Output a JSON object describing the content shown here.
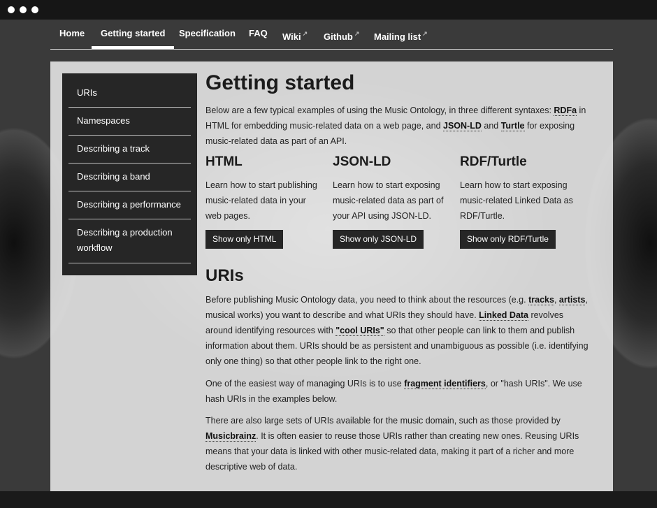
{
  "nav": {
    "items": [
      {
        "label": "Home"
      },
      {
        "label": "Getting started"
      },
      {
        "label": "Specification"
      },
      {
        "label": "FAQ"
      },
      {
        "label": "Wiki"
      },
      {
        "label": "Github"
      },
      {
        "label": "Mailing list"
      }
    ],
    "external_marker": "↗"
  },
  "sidebar": {
    "items": [
      {
        "label": "URIs"
      },
      {
        "label": "Namespaces"
      },
      {
        "label": "Describing a track"
      },
      {
        "label": "Describing a band"
      },
      {
        "label": "Describing a performance"
      },
      {
        "label": "Describing a production workflow"
      }
    ]
  },
  "main": {
    "title": "Getting started",
    "intro": {
      "t1": "Below are a few typical examples of using the Music Ontology, in three different syntaxes: ",
      "l1": "RDFa",
      "t2": " in HTML for embedding music-related data on a web page, and ",
      "l2": "JSON-LD",
      "t3": " and ",
      "l3": "Turtle",
      "t4": " for exposing music-related data as part of an API."
    },
    "columns": [
      {
        "heading": "HTML",
        "text": "Learn how to start publishing music-related data in your web pages.",
        "button": "Show only HTML"
      },
      {
        "heading": "JSON-LD",
        "text": "Learn how to start exposing music-related data as part of your API using JSON-LD.",
        "button": "Show only JSON-LD"
      },
      {
        "heading": "RDF/Turtle",
        "text": "Learn how to start exposing music-related Linked Data as RDF/Turtle.",
        "button": "Show only RDF/Turtle"
      }
    ],
    "uris": {
      "heading": "URIs",
      "p1": {
        "t1": "Before publishing Music Ontology data, you need to think about the resources (e.g. ",
        "l1": "tracks",
        "t2": ", ",
        "l2": "artists",
        "t3": ", musical works) you want to describe and what URIs they should have. ",
        "l3": "Linked Data",
        "t4": " revolves around identifying resources with ",
        "l4": "\"cool URIs\"",
        "t5": " so that other people can link to them and publish information about them. URIs should be as persistent and unambiguous as possible (i.e. identifying only one thing) so that other people link to the right one."
      },
      "p2": {
        "t1": "One of the easiest way of managing URIs is to use ",
        "l1": "fragment identifiers",
        "t2": ", or \"hash URIs\". We use hash URIs in the examples below."
      },
      "p3": {
        "t1": "There are also large sets of URIs available for the music domain, such as those provided by ",
        "l1": "Musicbrainz",
        "t2": ". It is often easier to reuse those URIs rather than creating new ones. Reusing URIs means that your data is linked with other music-related data, making it part of a richer and more descriptive web of data."
      }
    }
  }
}
